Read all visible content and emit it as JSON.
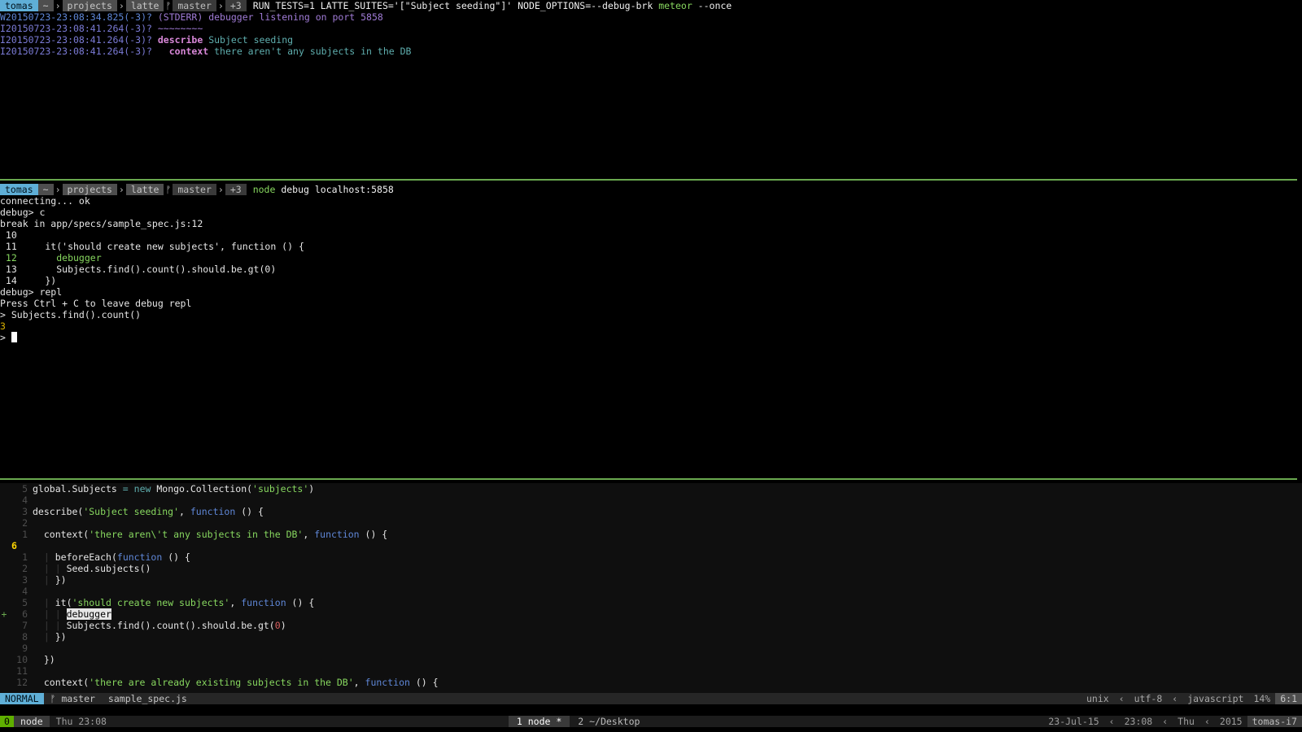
{
  "pane1": {
    "prompt": {
      "user": "tomas",
      "home": "~",
      "dir1": "projects",
      "dir2": "latte",
      "branch": "master",
      "changes": "+3"
    },
    "command": {
      "before": "RUN_TESTS=1 LATTE_SUITES='[\"Subject seeding\"]' NODE_OPTIONS=--debug-brk ",
      "app": "meteor",
      "after": " --once"
    },
    "log": [
      {
        "ts": "W20150723-23:08:34.825(-3)?",
        "tag": " (STDERR) ",
        "msg": "debugger listening on port 5858"
      },
      {
        "ts": "I20150723-23:08:41.264(-3)?",
        "msg": " ~~~~~~~~"
      },
      {
        "ts": "I20150723-23:08:41.264(-3)?",
        "kw": "describe",
        "msg": "Subject seeding"
      },
      {
        "ts": "I20150723-23:08:41.264(-3)?",
        "kw": "context",
        "msg": "there aren't any subjects in the DB"
      }
    ]
  },
  "pane2": {
    "prompt": {
      "user": "tomas",
      "home": "~",
      "dir1": "projects",
      "dir2": "latte",
      "branch": "master",
      "changes": "+3"
    },
    "command": {
      "app": "node",
      "after": " debug localhost:5858"
    },
    "lines": [
      "connecting... ok",
      "debug> c",
      "break in app/specs/sample_spec.js:12",
      " 10",
      " 11     it('should create new subjects', function () {",
      " 12       debugger",
      " 13       Subjects.find().count().should.be.gt(0)",
      " 14     })",
      "debug> repl",
      "Press Ctrl + C to leave debug repl",
      "> Subjects.find().count()"
    ],
    "result": "3",
    "input_prompt": "> "
  },
  "vim": {
    "lines": [
      {
        "n": "5",
        "t": [
          [
            "global.Subjects ",
            ""
          ],
          [
            "= ",
            "teal"
          ],
          [
            "new ",
            "teal"
          ],
          [
            "Mongo.Collection(",
            ""
          ],
          [
            "'subjects'",
            "str"
          ],
          [
            ")",
            ""
          ]
        ]
      },
      {
        "n": "4",
        "t": []
      },
      {
        "n": "3",
        "t": [
          [
            "describe(",
            ""
          ],
          [
            "'Subject seeding'",
            "str"
          ],
          [
            ", ",
            ""
          ],
          [
            "function",
            "kw"
          ],
          [
            " () {",
            ""
          ]
        ]
      },
      {
        "n": "2",
        "t": []
      },
      {
        "n": "1",
        "t": [
          [
            "  context(",
            ""
          ],
          [
            "'there aren\\'t any subjects in the DB'",
            "str"
          ],
          [
            ", ",
            ""
          ],
          [
            "function",
            "kw"
          ],
          [
            " () {",
            ""
          ]
        ]
      },
      {
        "n": "6",
        "cur": true,
        "t": []
      },
      {
        "n": "1",
        "t": [
          [
            "  ",
            ""
          ],
          [
            "| ",
            "guide"
          ],
          [
            "beforeEach(",
            ""
          ],
          [
            "function",
            "kw"
          ],
          [
            " () {",
            ""
          ]
        ]
      },
      {
        "n": "2",
        "t": [
          [
            "  ",
            ""
          ],
          [
            "| | ",
            "guide"
          ],
          [
            "Seed.subjects()",
            ""
          ]
        ]
      },
      {
        "n": "3",
        "t": [
          [
            "  ",
            ""
          ],
          [
            "| ",
            "guide"
          ],
          [
            "})",
            ""
          ]
        ]
      },
      {
        "n": "4",
        "t": []
      },
      {
        "n": "5",
        "t": [
          [
            "  ",
            ""
          ],
          [
            "| ",
            "guide"
          ],
          [
            "it(",
            ""
          ],
          [
            "'should create new subjects'",
            "str"
          ],
          [
            ", ",
            ""
          ],
          [
            "function",
            "kw"
          ],
          [
            " () {",
            ""
          ]
        ]
      },
      {
        "n": "6",
        "sign": "+",
        "t": [
          [
            "  ",
            ""
          ],
          [
            "| | ",
            "guide"
          ],
          [
            "debugger",
            "hl"
          ]
        ]
      },
      {
        "n": "7",
        "t": [
          [
            "  ",
            ""
          ],
          [
            "| | ",
            "guide"
          ],
          [
            "Subjects.find().count().should.be.gt(",
            ""
          ],
          [
            "0",
            "num"
          ],
          [
            ")",
            ""
          ]
        ]
      },
      {
        "n": "8",
        "t": [
          [
            "  ",
            ""
          ],
          [
            "| ",
            "guide"
          ],
          [
            "})",
            ""
          ]
        ]
      },
      {
        "n": "9",
        "t": []
      },
      {
        "n": "10",
        "t": [
          [
            "  })",
            ""
          ]
        ]
      },
      {
        "n": "11",
        "t": []
      },
      {
        "n": "12",
        "t": [
          [
            "  context(",
            ""
          ],
          [
            "'there are already existing subjects in the DB'",
            "str"
          ],
          [
            ", ",
            ""
          ],
          [
            "function",
            "kw"
          ],
          [
            " () {",
            ""
          ]
        ]
      }
    ],
    "status": {
      "mode": "NORMAL",
      "branch": "master",
      "file": "sample_spec.js",
      "format": "unix",
      "encoding": "utf-8",
      "filetype": "javascript",
      "percent": "14%",
      "position": "6:1"
    }
  },
  "tmux": {
    "session_index": "0",
    "session_name": "node",
    "clock": "Thu 23:08",
    "windows": [
      {
        "label": "1 node *",
        "active": true
      },
      {
        "label": "2 ~/Desktop",
        "active": false
      }
    ],
    "date": "23-Jul-15",
    "time": "23:08",
    "day": "Thu",
    "year": "2015",
    "host": "tomas-i7"
  },
  "colors": {
    "split": "#6aa84f",
    "accent": "#5fafd7",
    "session": "#5faf00"
  }
}
